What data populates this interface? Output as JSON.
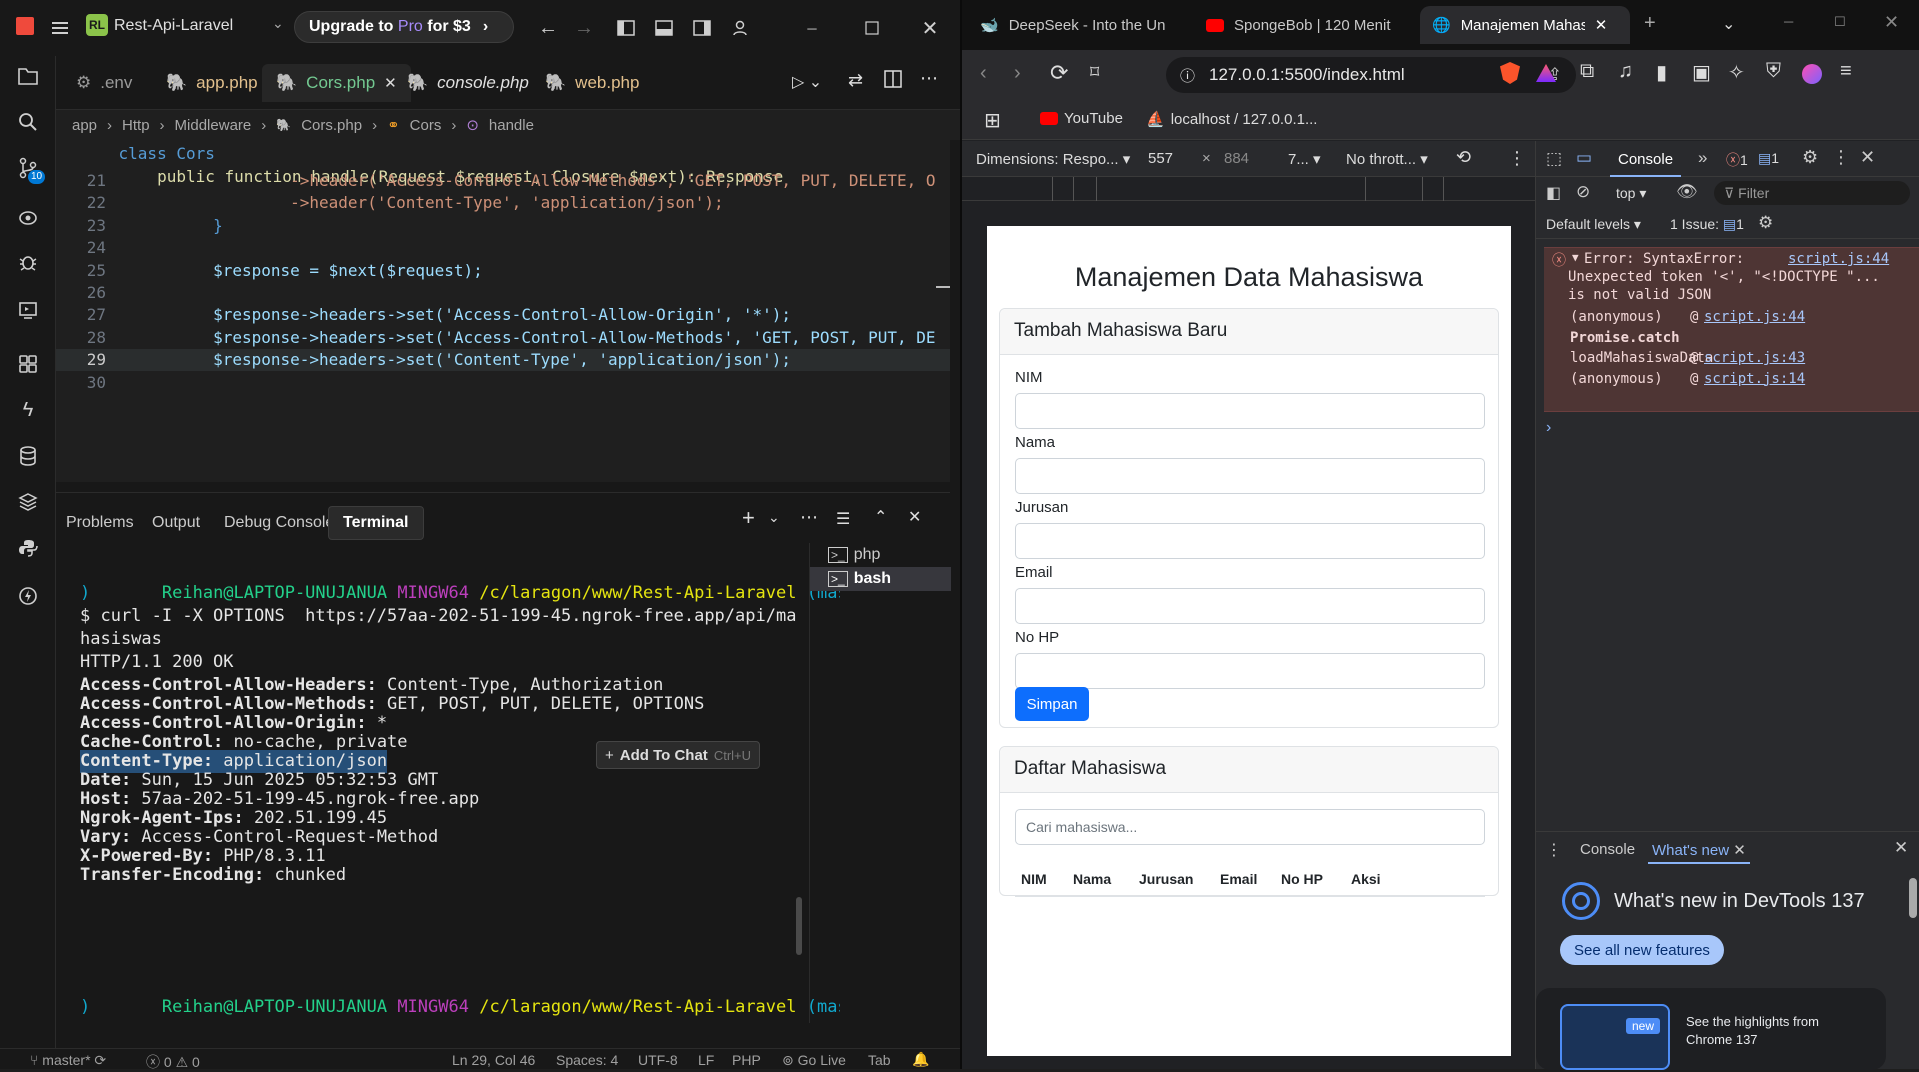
{
  "editor": {
    "project": "Rest-Api-Laravel",
    "project_badge": "RL",
    "upgrade": {
      "pre": "Upgrade to ",
      "pro": "Pro",
      "post": " for $3"
    },
    "activity_badge": "10",
    "tabs": [
      {
        "label": ".env",
        "active": false
      },
      {
        "label": "app.php",
        "active": false
      },
      {
        "label": "Cors.php",
        "active": true
      },
      {
        "label": "console.php",
        "active": false
      },
      {
        "label": "web.php",
        "active": false
      }
    ],
    "breadcrumb": [
      "app",
      "Http",
      "Middleware",
      "Cors.php",
      "Cors",
      "handle"
    ],
    "code_header": [
      "    class Cors",
      "        public function handle(Request $request, Closure $next): Response"
    ],
    "lines": [
      {
        "n": "21",
        "t": "                ->header('Access-Control-Allow-Methods', 'GET, POST, PUT, DELETE, O"
      },
      {
        "n": "22",
        "t": "                ->header('Content-Type', 'application/json');"
      },
      {
        "n": "23",
        "t": "        }"
      },
      {
        "n": "24",
        "t": ""
      },
      {
        "n": "25",
        "t": "        $response = $next($request);"
      },
      {
        "n": "26",
        "t": ""
      },
      {
        "n": "27",
        "t": "        $response->headers->set('Access-Control-Allow-Origin', '*');"
      },
      {
        "n": "28",
        "t": "        $response->headers->set('Access-Control-Allow-Methods', 'GET, POST, PUT, DE"
      },
      {
        "n": "29",
        "t": "        $response->headers->set('Content-Type', 'application/json');"
      },
      {
        "n": "30",
        "t": ""
      }
    ],
    "current_line": "29",
    "panel_tabs": [
      "Problems",
      "Output",
      "Debug Console",
      "Terminal"
    ],
    "terminal": {
      "prompt_user": "Reihan@LAPTOP-UNUJANUA",
      "prompt_env": "MINGW64",
      "prompt_path": "/c/laragon/www/Rest-Api-Laravel",
      "prompt_branch": "(master",
      "prompt_close": ")",
      "command": "$ curl -I -X OPTIONS  https://57aa-202-51-199-45.ngrok-free.app/api/ma",
      "command_wrap": "hasiswas",
      "status": "HTTP/1.1 200 OK",
      "headers": [
        {
          "k": "Access-Control-Allow-Headers:",
          "v": " Content-Type, Authorization"
        },
        {
          "k": "Access-Control-Allow-Methods:",
          "v": " GET, POST, PUT, DELETE, OPTIONS"
        },
        {
          "k": "Access-Control-Allow-Origin:",
          "v": " *"
        },
        {
          "k": "Cache-Control:",
          "v": " no-cache, private"
        },
        {
          "k": "Content-Type:",
          "v": " application/json"
        },
        {
          "k": "Date:",
          "v": " Sun, 15 Jun 2025 05:32:53 GMT"
        },
        {
          "k": "Host:",
          "v": " 57aa-202-51-199-45.ngrok-free.app"
        },
        {
          "k": "Ngrok-Agent-Ips:",
          "v": " 202.51.199.45"
        },
        {
          "k": "Vary:",
          "v": " Access-Control-Request-Method"
        },
        {
          "k": "X-Powered-By:",
          "v": " PHP/8.3.11"
        },
        {
          "k": "Transfer-Encoding:",
          "v": " chunked"
        }
      ],
      "add_to_chat": "Add To Chat",
      "add_to_chat_key": "Ctrl+U",
      "shells": [
        "php",
        "bash"
      ]
    },
    "status": {
      "branch": "master*",
      "errors": "0",
      "warnings": "0",
      "position": "Ln 29, Col 46",
      "spaces": "Spaces: 4",
      "encoding": "UTF-8",
      "eol": "LF",
      "language": "PHP",
      "golive": "Go Live",
      "tab": "Tab"
    }
  },
  "browser": {
    "tabs": [
      {
        "label": "DeepSeek - Into the Un",
        "active": false
      },
      {
        "label": "SpongeBob | 120 Menit",
        "active": false
      },
      {
        "label": "Manajemen Mahas",
        "active": true
      }
    ],
    "url": "127.0.0.1:5500/index.html",
    "bookmarks": [
      "YouTube",
      "localhost / 127.0.0.1..."
    ],
    "devbar": {
      "dimensions": "Dimensions: Respo...",
      "width": "557",
      "height": "884",
      "zoom": "7...",
      "throttle": "No thrott..."
    },
    "page": {
      "title": "Manajemen Data Mahasiswa",
      "form_title": "Tambah Mahasiswa Baru",
      "fields": [
        "NIM",
        "Nama",
        "Jurusan",
        "Email",
        "No HP"
      ],
      "submit": "Simpan",
      "list_title": "Daftar Mahasiswa",
      "search_placeholder": "Cari mahasiswa...",
      "columns": [
        "NIM",
        "Nama",
        "Jurusan",
        "Email",
        "No HP",
        "Aksi"
      ]
    },
    "devtools": {
      "tab": "Console",
      "errors_count": "1",
      "messages_count": "1",
      "context": "top",
      "filter": "Filter",
      "levels": "Default levels",
      "issues": "1 Issue:",
      "issues_count": "1",
      "error_lines": [
        "Error: SyntaxError:",
        "Unexpected token '<', \"<!DOCTYPE \"...",
        "is not valid JSON"
      ],
      "error_source": "script.js:44",
      "stack": [
        {
          "fn": "(anonymous)",
          "src": "script.js:44",
          "bold": false
        },
        {
          "fn": "Promise.catch",
          "src": "",
          "bold": true
        },
        {
          "fn": "loadMahasiswaData",
          "src": "script.js:43",
          "bold": false
        },
        {
          "fn": "(anonymous)",
          "src": "script.js:14",
          "bold": false
        }
      ],
      "drawer_tabs": [
        "Console",
        "What's new"
      ],
      "whats_new_title": "What's new in DevTools 137",
      "see_all": "See all new features",
      "new_badge": "new",
      "highlights": "See the highlights from",
      "highlights_2": "Chrome 137"
    }
  },
  "colors": {
    "keyword": "#569cd6",
    "function": "#dcdcaa",
    "string": "#ce9178",
    "variable": "#9cdcfe",
    "type": "#4ec9b0",
    "term_green": "#23d18b",
    "term_purple": "#bc3fbc",
    "term_yellow": "#e5e510",
    "term_cyan": "#11a8cd",
    "bootstrap_primary": "#0d6efd",
    "error_red": "#f28b82"
  }
}
